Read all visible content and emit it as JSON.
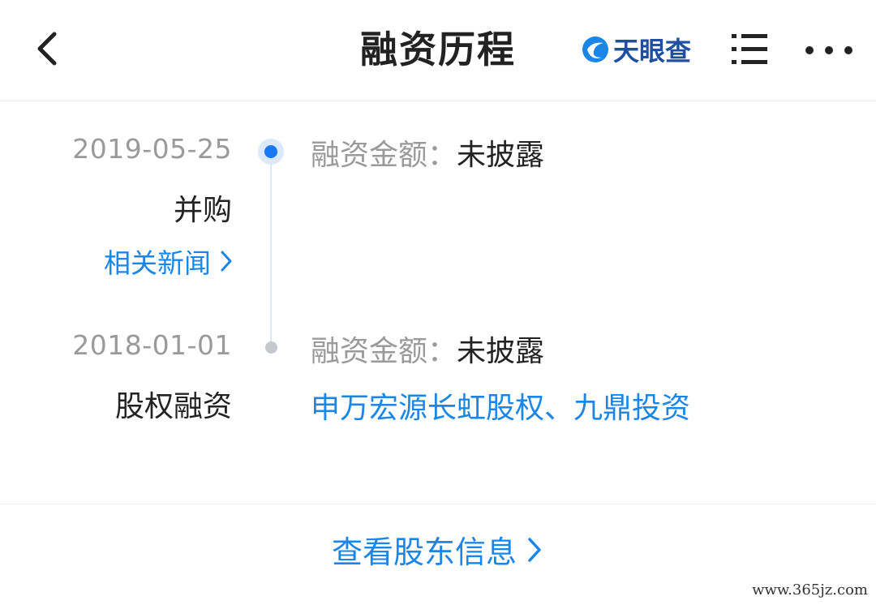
{
  "header": {
    "back_icon": "chevron-left-icon",
    "title": "融资历程",
    "brand_name": "天眼查",
    "brand_logo": "tianyancha-logo-icon",
    "menu_icon": "list-menu-icon",
    "more_icon": "more-horizontal-icon"
  },
  "timeline": {
    "events": [
      {
        "date": "2019-05-25",
        "round": "并购",
        "news_link": "相关新闻",
        "amount_label": "融资金额：",
        "amount_value": "未披露",
        "investors": ""
      },
      {
        "date": "2018-01-01",
        "round": "股权融资",
        "news_link": "",
        "amount_label": "融资金额：",
        "amount_value": "未披露",
        "investors": "申万宏源长虹股权、九鼎投资"
      }
    ]
  },
  "footer": {
    "link_label": "查看股东信息"
  },
  "watermark": "www.365jz.com",
  "colors": {
    "accent": "#1a86e8",
    "timeline_dot_active": "#1877f2",
    "timeline_dot_inactive": "#c4c8cf",
    "text_primary": "#222222",
    "text_secondary": "#9a9a9a",
    "brand": "#1f4fa0"
  }
}
